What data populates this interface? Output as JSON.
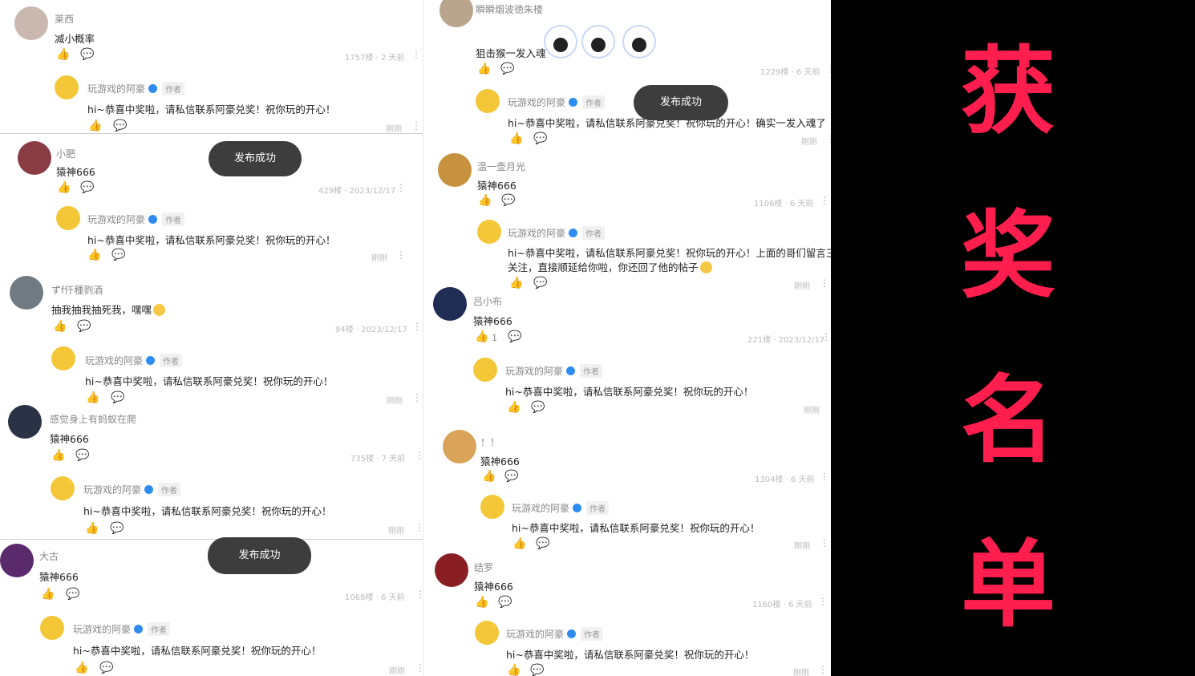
{
  "banner": {
    "chars": [
      "获",
      "奖",
      "名",
      "单"
    ]
  },
  "toast_text": "发布成功",
  "reply_author": "玩游戏的阿豪",
  "author_tag": "作者",
  "reply_time": "刚刚",
  "left": [
    {
      "user": "莱西",
      "text": "减小概率",
      "meta": "1757楼 · 2 天前",
      "reply": "hi~恭喜中奖啦，请私信联系阿豪兑奖！祝你玩的开心！"
    },
    {
      "user": "小肥",
      "text": "猿神666",
      "meta": "429楼 · 2023/12/17",
      "reply": "hi~恭喜中奖啦，请私信联系阿豪兑奖！祝你玩的开心！"
    },
    {
      "user": "ずf仟種剹酒",
      "text": "抽我抽我抽死我，嘿嘿",
      "meta": "94楼 · 2023/12/17",
      "reply": "hi~恭喜中奖啦，请私信联系阿豪兑奖！祝你玩的开心！"
    },
    {
      "user": "感觉身上有蚂蚁在爬",
      "text": "猿神666",
      "meta": "735楼 · 7 天前",
      "reply": "hi~恭喜中奖啦，请私信联系阿豪兑奖！祝你玩的开心！"
    },
    {
      "user": "大古",
      "text": "猿神666",
      "meta": "1068楼 · 6 天前",
      "reply": "hi~恭喜中奖啦，请私信联系阿豪兑奖！祝你玩的开心！"
    }
  ],
  "right": [
    {
      "user": "瞬瞬烟波徳朱楼",
      "text": "狙击猴一发入魂",
      "meta": "1229楼 · 6 天前",
      "reply": "hi~恭喜中奖啦，请私信联系阿豪兑奖！祝你玩的开心！确实一发入魂了"
    },
    {
      "user": "温一壶月光",
      "text": "猿神666",
      "meta": "1106楼 · 6 天前",
      "reply": "hi~恭喜中奖啦，请私信联系阿豪兑奖！祝你玩的开心！上面的哥们留言三次没",
      "reply2": "关注，直接顺延给你啦，你还回了他的帖子"
    },
    {
      "user": "吕小布",
      "text": "猿神666",
      "likes": "1",
      "meta": "221楼 · 2023/12/17",
      "reply": "hi~恭喜中奖啦，请私信联系阿豪兑奖！祝你玩的开心！"
    },
    {
      "user": "！！",
      "text": "猿神666",
      "meta": "1304楼 · 6 天前",
      "reply": "hi~恭喜中奖啦，请私信联系阿豪兑奖！祝你玩的开心！"
    },
    {
      "user": "结罗",
      "text": "猿神666",
      "meta": "1160楼 · 6 天前",
      "reply": "hi~恭喜中奖啦，请私信联系阿豪兑奖！祝你玩的开心！"
    }
  ]
}
